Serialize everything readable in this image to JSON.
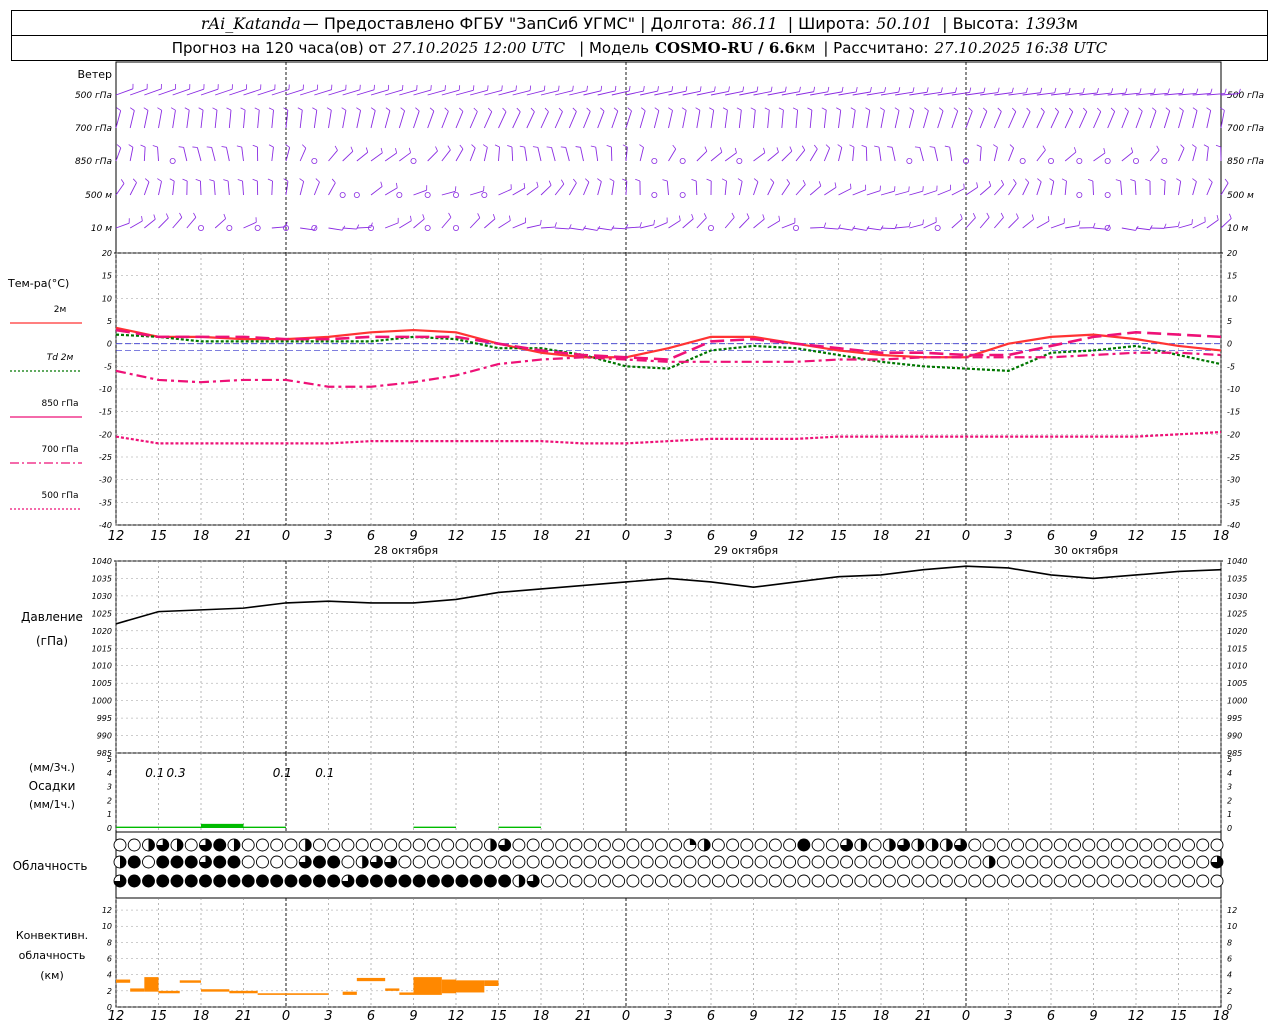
{
  "header": {
    "station": "rAi_Katanda",
    "provided_label": " — Предоставлено ФГБУ \"ЗапСиб УГМС\" | Долгота:",
    "longitude": "86.11",
    "lat_label": "| Широта:",
    "latitude": "50.101",
    "alt_label": "| Высота:",
    "altitude": "1393",
    "alt_unit": "м",
    "forecast_label": "Прогноз на 120 часа(ов) от",
    "forecast_start": "27.10.2025 12:00 UTC",
    "model_label": "| Модель",
    "model": "COSMO-RU / 6.6",
    "model_unit": "км",
    "calc_label": "| Рассчитано:",
    "calc_time": "27.10.2025 16:38 UTC"
  },
  "colors": {
    "wind": "#8a2be2",
    "t2m": "#ff3333",
    "td2m": "#007700",
    "t850": "#ee1177",
    "t700": "#ee1177",
    "t500": "#ee1177",
    "pressure": "#000000",
    "precip": "#00bb00",
    "conv": "#ff8800",
    "grid": "#000000"
  },
  "wind_panel": {
    "title": "Ветер",
    "levels": [
      "500 гПа",
      "700 гПа",
      "850 гПа",
      "500 м",
      "10 м"
    ]
  },
  "temp_panel": {
    "title": "Тем-ра(°C)",
    "legend": [
      {
        "label": "2м",
        "style": "solid",
        "color": "#ff3333"
      },
      {
        "label": "Td  2м",
        "style": "dot",
        "color": "#007700"
      },
      {
        "label": "850 гПа",
        "style": "solid",
        "color": "#ee1177"
      },
      {
        "label": "700 гПа",
        "style": "dashdot",
        "color": "#ee1177"
      },
      {
        "label": "500 гПа",
        "style": "dot",
        "color": "#ee1177"
      }
    ]
  },
  "pressure_panel": {
    "title1": "Давление",
    "title2": "(гПа)"
  },
  "precip_panel": {
    "unit1": "(мм/3ч.)",
    "title": "Осадки",
    "unit2": "(мм/1ч.)",
    "labels": [
      {
        "x": 3,
        "text": "0.1"
      },
      {
        "x": 6,
        "text": "0.3"
      },
      {
        "x": 21,
        "text": "0.1"
      },
      {
        "x": 27,
        "text": "0.1"
      }
    ]
  },
  "cloud_panel": {
    "title": "Облачность"
  },
  "conv_panel": {
    "title1": "Конвективн.",
    "title2": "облачность",
    "title3": "(км)"
  },
  "day_labels": [
    {
      "x": 24,
      "text": "28 октября"
    },
    {
      "x": 48,
      "text": "29 октября"
    },
    {
      "x": 72,
      "text": "30 октября"
    }
  ],
  "chart_data": [
    {
      "type": "line",
      "name": "temperature",
      "xlabel": "",
      "ylabel": "Тем-ра(°C)",
      "ylim": [
        -40,
        20
      ],
      "yticks": [
        20,
        15,
        10,
        5,
        0,
        -5,
        -10,
        -15,
        -20,
        -25,
        -30,
        -35,
        -40
      ],
      "x_hours_from_start": [
        0,
        3,
        6,
        9,
        12,
        15,
        18,
        21,
        24,
        27,
        30,
        33,
        36,
        39,
        42,
        45,
        48,
        51,
        54,
        57,
        60,
        63,
        66,
        69,
        72,
        75,
        78
      ],
      "x_tick_labels": [
        "12",
        "15",
        "18",
        "21",
        "0",
        "3",
        "6",
        "9",
        "12",
        "15",
        "18",
        "21",
        "0",
        "3",
        "6",
        "9",
        "12",
        "15",
        "18",
        "21",
        "0",
        "3",
        "6",
        "9",
        "12",
        "15",
        "18"
      ],
      "series": [
        {
          "name": "2м",
          "color": "#ff3333",
          "values": [
            3.5,
            1.5,
            1.5,
            1,
            1,
            1.5,
            2.5,
            3,
            2.5,
            0,
            -2,
            -3,
            -3,
            -1,
            1.5,
            1.5,
            0,
            -1.5,
            -2.5,
            -3,
            -3,
            0,
            1.5,
            2,
            1,
            -0.5,
            -1.5
          ]
        },
        {
          "name": "Td 2м",
          "color": "#007700",
          "values": [
            2,
            1.5,
            0.5,
            0.5,
            0.5,
            0.5,
            0.5,
            1.5,
            1,
            -1,
            -1,
            -2.5,
            -5,
            -5.5,
            -1.5,
            -0.5,
            -1,
            -2.5,
            -4,
            -5,
            -5.5,
            -6,
            -2,
            -1.5,
            -0.5,
            -2.5,
            -4.5
          ]
        },
        {
          "name": "850 гПа",
          "color": "#ee1177",
          "values": [
            3,
            1.5,
            1.5,
            1.5,
            1,
            1,
            1.5,
            1.5,
            1.5,
            0,
            -1.5,
            -2.5,
            -3,
            -3.5,
            0.5,
            1,
            0,
            -1,
            -2,
            -2,
            -2.5,
            -2.5,
            -0.5,
            1.5,
            2.5,
            2,
            1.5
          ]
        },
        {
          "name": "700 гПа",
          "color": "#ee1177",
          "values": [
            -6,
            -8,
            -8.5,
            -8,
            -8,
            -9.5,
            -9.5,
            -8.5,
            -7,
            -4.5,
            -3.5,
            -3,
            -3.5,
            -4,
            -4,
            -4,
            -4,
            -3.5,
            -3.5,
            -3,
            -3,
            -3,
            -3,
            -2.5,
            -2,
            -2,
            -2.5
          ]
        },
        {
          "name": "500 гПа",
          "color": "#ee1177",
          "values": [
            -20.5,
            -22,
            -22,
            -22,
            -22,
            -22,
            -21.5,
            -21.5,
            -21.5,
            -21.5,
            -21.5,
            -22,
            -22,
            -21.5,
            -21,
            -21,
            -21,
            -20.5,
            -20.5,
            -20.5,
            -20.5,
            -20.5,
            -20.5,
            -20.5,
            -20.5,
            -20,
            -19.5
          ]
        }
      ]
    },
    {
      "type": "line",
      "name": "pressure",
      "ylabel": "Давление (гПа)",
      "ylim": [
        985,
        1040
      ],
      "yticks": [
        1040,
        1035,
        1030,
        1025,
        1020,
        1015,
        1010,
        1005,
        1000,
        995,
        990,
        985
      ],
      "x_hours_from_start": [
        0,
        3,
        6,
        9,
        12,
        15,
        18,
        21,
        24,
        27,
        30,
        33,
        36,
        39,
        42,
        45,
        48,
        51,
        54,
        57,
        60,
        63,
        66,
        69,
        72,
        75,
        78
      ],
      "series": [
        {
          "name": "Давление",
          "color": "#000000",
          "values": [
            1022,
            1025.5,
            1026,
            1026.5,
            1028,
            1028.5,
            1028,
            1028,
            1029,
            1031,
            1032,
            1033,
            1034,
            1035,
            1034,
            1032.5,
            1034,
            1035.5,
            1036,
            1037.5,
            1038.5,
            1038,
            1036,
            1035,
            1036,
            1037,
            1037.5
          ]
        }
      ]
    },
    {
      "type": "bar",
      "name": "precipitation",
      "ylabel": "Осадки (мм/1ч.)",
      "ylim": [
        0,
        5
      ],
      "yticks": [
        5,
        4,
        3,
        2,
        1,
        0
      ],
      "x_hours_from_start": [
        0,
        3,
        6,
        9,
        12,
        15,
        18,
        21,
        24,
        27,
        30,
        33,
        36,
        39,
        42,
        45,
        48,
        51,
        54,
        57,
        60,
        63,
        66,
        69,
        72,
        75,
        78
      ],
      "values": [
        0.1,
        0.1,
        0.3,
        0.1,
        0,
        0,
        0,
        0.1,
        0,
        0.1,
        0,
        0,
        0,
        0,
        0,
        0,
        0,
        0,
        0,
        0,
        0,
        0,
        0,
        0,
        0,
        0,
        0
      ]
    },
    {
      "type": "bar",
      "name": "convective_cloud",
      "ylabel": "Конвективн. облачность (км)",
      "ylim": [
        0,
        13
      ],
      "yticks": [
        12,
        10,
        8,
        6,
        4,
        2,
        0
      ],
      "bars": [
        {
          "x0": 0,
          "x1": 1,
          "bottom": 3.0,
          "top": 3.4
        },
        {
          "x0": 1,
          "x1": 2,
          "bottom": 1.9,
          "top": 2.3
        },
        {
          "x0": 2,
          "x1": 3,
          "bottom": 1.9,
          "top": 3.7
        },
        {
          "x0": 3,
          "x1": 4.5,
          "bottom": 1.7,
          "top": 2.0
        },
        {
          "x0": 4.5,
          "x1": 6,
          "bottom": 3.0,
          "top": 3.3
        },
        {
          "x0": 6,
          "x1": 8,
          "bottom": 1.9,
          "top": 2.2
        },
        {
          "x0": 8,
          "x1": 10,
          "bottom": 1.7,
          "top": 2.0
        },
        {
          "x0": 10,
          "x1": 15,
          "bottom": 1.5,
          "top": 1.7
        },
        {
          "x0": 16,
          "x1": 17,
          "bottom": 1.5,
          "top": 1.9
        },
        {
          "x0": 17,
          "x1": 19,
          "bottom": 3.2,
          "top": 3.6
        },
        {
          "x0": 19,
          "x1": 20,
          "bottom": 2.0,
          "top": 2.3
        },
        {
          "x0": 20,
          "x1": 21,
          "bottom": 1.5,
          "top": 1.8
        },
        {
          "x0": 21,
          "x1": 23,
          "bottom": 1.5,
          "top": 3.7
        },
        {
          "x0": 23,
          "x1": 24,
          "bottom": 1.7,
          "top": 3.4
        },
        {
          "x0": 24,
          "x1": 26,
          "bottom": 1.8,
          "top": 3.3
        },
        {
          "x0": 26,
          "x1": 27,
          "bottom": 2.6,
          "top": 3.3
        }
      ]
    },
    {
      "type": "heatmap",
      "name": "cloudiness",
      "rows": [
        [
          0,
          0,
          2,
          3,
          2,
          0,
          3,
          4,
          2,
          0,
          0,
          0,
          0,
          2,
          0,
          0,
          0,
          0,
          0,
          0,
          0,
          0,
          0,
          0,
          0,
          0,
          2,
          3,
          0,
          0,
          0,
          0,
          0,
          0,
          0,
          0,
          0,
          0,
          0,
          0,
          1,
          2,
          0,
          0,
          0,
          0,
          0,
          0,
          4,
          0,
          0,
          3,
          2,
          0,
          2,
          3,
          2,
          2,
          2,
          3,
          0,
          0,
          0,
          0,
          0,
          0,
          0,
          0,
          0,
          0,
          0,
          0,
          0,
          0,
          0,
          0,
          0,
          0
        ],
        [
          2,
          4,
          0,
          4,
          4,
          4,
          3,
          4,
          4,
          0,
          0,
          0,
          0,
          3,
          4,
          4,
          0,
          2,
          3,
          3,
          0,
          0,
          0,
          0,
          0,
          0,
          0,
          0,
          0,
          0,
          0,
          0,
          0,
          0,
          0,
          0,
          0,
          0,
          0,
          0,
          0,
          0,
          0,
          0,
          0,
          0,
          0,
          0,
          0,
          0,
          0,
          0,
          0,
          0,
          0,
          0,
          0,
          0,
          0,
          0,
          0,
          2,
          0,
          0,
          0,
          0,
          0,
          0,
          0,
          0,
          0,
          0,
          0,
          0,
          0,
          0,
          0,
          3
        ],
        [
          3,
          4,
          4,
          4,
          4,
          4,
          4,
          4,
          4,
          4,
          4,
          4,
          4,
          4,
          4,
          4,
          3,
          4,
          4,
          4,
          4,
          4,
          4,
          4,
          4,
          4,
          4,
          4,
          2,
          3,
          0,
          0,
          0,
          0,
          0,
          0,
          0,
          0,
          0,
          0,
          0,
          0,
          0,
          0,
          0,
          0,
          0,
          0,
          0,
          0,
          0,
          0,
          0,
          0,
          0,
          0,
          0,
          0,
          0,
          0,
          0,
          0,
          0,
          0,
          0,
          0,
          0,
          0,
          0,
          0,
          0,
          0,
          0,
          0,
          0,
          0,
          0,
          0
        ]
      ]
    }
  ]
}
